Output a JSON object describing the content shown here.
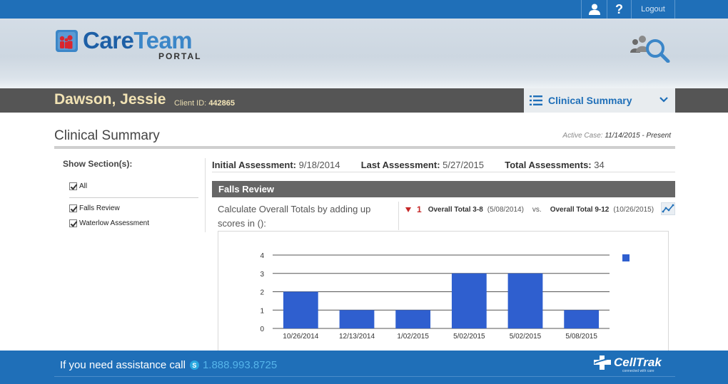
{
  "topbar": {
    "logout_label": "Logout",
    "help_label": "?",
    "user_icon": "user-icon"
  },
  "brand": {
    "name_part1": "Care",
    "name_part2": "Team",
    "subtitle": "PORTAL",
    "icon": "careteam-logo-icon",
    "colors": {
      "primary": "#1f6fb8",
      "dark": "#1d5fa6",
      "light": "#3b86c8"
    }
  },
  "header": {
    "search_icon": "people-search-icon"
  },
  "client": {
    "name": "Dawson, Jessie",
    "id_label": "Client ID:",
    "id_value": "442865"
  },
  "section_select": {
    "selected": "Clinical Summary",
    "icon": "list-icon"
  },
  "page": {
    "title": "Clinical Summary",
    "active_case_label": "Active Case:",
    "active_case_value": "11/14/2015 - Present"
  },
  "sidebar": {
    "heading": "Show Section(s):",
    "items": [
      {
        "label": "All",
        "checked": true
      },
      {
        "label": "Falls Review",
        "checked": true
      },
      {
        "label": "Waterlow Assessment",
        "checked": true
      }
    ]
  },
  "assessments": {
    "initial_label": "Initial Assessment:",
    "initial_value": "9/18/2014",
    "last_label": "Last Assessment:",
    "last_value": "5/27/2015",
    "total_label": "Total Assessments:",
    "total_value": "34"
  },
  "falls_review": {
    "title": "Falls Review",
    "calc_text": "Calculate Overall Totals by adding up scores in ():",
    "change_value": "1",
    "from_label": "Overall Total 3-8",
    "from_date": "(5/08/2014)",
    "vs_label": "vs.",
    "to_label": "Overall Total 9-12",
    "to_date": "(10/26/2015)",
    "trend_icon": "trend-chart-icon",
    "down_color": "#c62828"
  },
  "chart_data": {
    "type": "bar",
    "categories": [
      "10/26/2014",
      "12/13/2014",
      "1/02/2015",
      "5/02/2015",
      "5/02/2015",
      "5/08/2015"
    ],
    "values": [
      2,
      1,
      1,
      3,
      3,
      1
    ],
    "yticks": [
      0,
      1,
      2,
      3,
      4
    ],
    "ylim": [
      0,
      4
    ],
    "grid": true,
    "legend": "top-right",
    "bar_color": "#2f5fcf"
  },
  "footer": {
    "assist_text": "If you need assistance call",
    "phone": "1.888.993.8725",
    "brand": "CellTrak",
    "brand_tagline": "connected with care",
    "skype_icon": "skype-icon"
  }
}
